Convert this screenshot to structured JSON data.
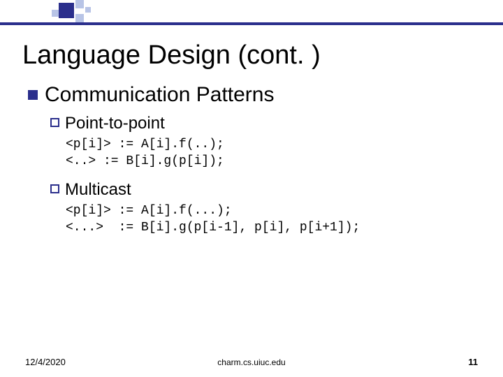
{
  "title": "Language Design (cont. )",
  "bullet1": "Communication Patterns",
  "sub1": "Point-to-point",
  "code1": "<p[i]> := A[i].f(..);\n<..> := B[i].g(p[i]);",
  "sub2": "Multicast",
  "code2": "<p[i]> := A[i].f(...);\n<...>  := B[i].g(p[i-1], p[i], p[i+1]);",
  "footer": {
    "date": "12/4/2020",
    "source": "charm.cs.uiuc.edu",
    "page": "11"
  }
}
